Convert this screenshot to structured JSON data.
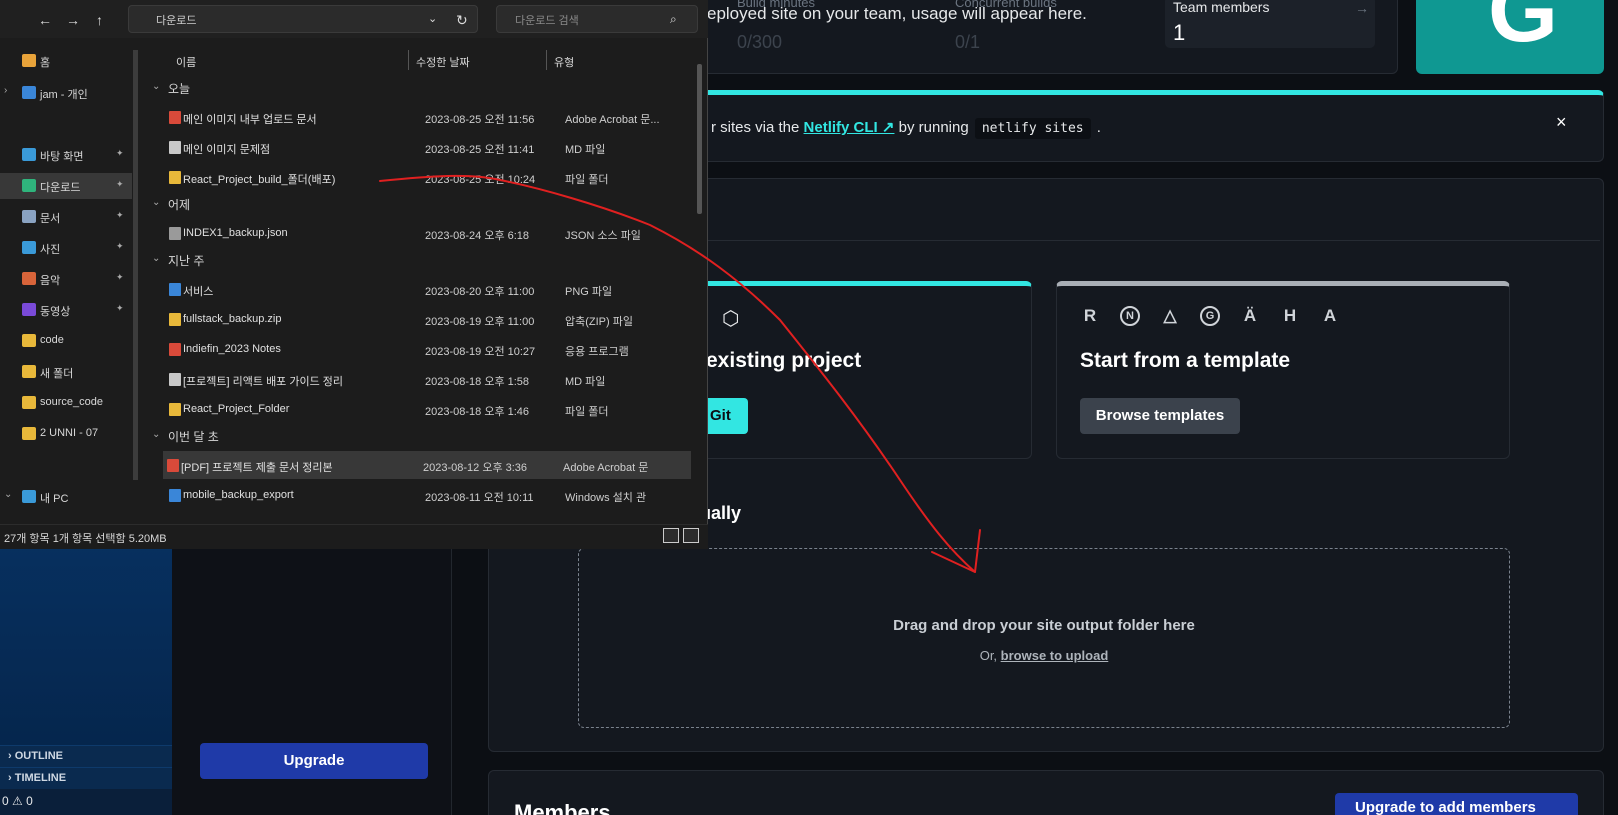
{
  "vscode": {
    "outline_label": "OUTLINE",
    "timeline_label": "TIMELINE",
    "status_text": "0 ⚠ 0"
  },
  "netlify": {
    "usage": {
      "text": "eployed site on your team, usage will appear here.",
      "build_minutes_label": "Build minutes",
      "build_minutes_value": "0/300",
      "concurrent_label": "Concurrent builds",
      "concurrent_value": "0/1"
    },
    "team": {
      "label": "Team members",
      "arrow": "→",
      "count": "1"
    },
    "avatar_letter": "G",
    "cli_banner": {
      "prefix": "r sites via the ",
      "link": "Netlify CLI ↗",
      "middle": " by running ",
      "code": "netlify sites",
      "suffix": " .",
      "close": "×"
    },
    "import_card": {
      "title": "existing project",
      "button": "Git"
    },
    "template_card": {
      "title": "Start from a template",
      "button": "Browse templates",
      "icons": [
        "R",
        "N",
        "△",
        "G",
        "Ä",
        "H",
        "A"
      ]
    },
    "manual_label": "ually",
    "dropzone": {
      "title": "Drag and drop your site output folder here",
      "sub_prefix": "Or, ",
      "sub_link": "browse to upload"
    },
    "members_title": "Members",
    "members_button": "Upgrade to add members",
    "upgrade_button": "Upgrade",
    "colors": {
      "accent": "#32e6e2",
      "upgrade": "#1f3aa8",
      "avatar": "#0f9892"
    }
  },
  "explorer": {
    "toolbar_glyphs": [
      "←",
      "→",
      "↑",
      "↻"
    ],
    "address_text": "다운로드",
    "search_placeholder": "다운로드 검색",
    "nav": [
      {
        "label": "홈"
      },
      {
        "label": "jam - 개인"
      },
      {
        "label": "바탕 화면"
      },
      {
        "label": "다운로드"
      },
      {
        "label": "문서"
      },
      {
        "label": "사진"
      },
      {
        "label": "음악"
      },
      {
        "label": "동영상"
      },
      {
        "label": "code"
      },
      {
        "label": "새 폴더"
      },
      {
        "label": "source_code"
      },
      {
        "label": "2 UNNI - 07"
      },
      {
        "label": "내 PC"
      }
    ],
    "columns": {
      "name": "이름",
      "date": "수정한 날짜",
      "type": "유형"
    },
    "groups": {
      "today": "오늘",
      "yesterday": "어제",
      "last_week": "지난 주",
      "earlier": "이번 달 초"
    },
    "rows_today": [
      {
        "name": "메인 이미지 내부 업로드 문서",
        "date": "2023-08-25 오전 11:56",
        "type": "Adobe Acrobat 문..."
      },
      {
        "name": "메인 이미지 문제점",
        "date": "2023-08-25 오전 11:41",
        "type": "MD 파일"
      },
      {
        "name": "React_Project_build_폴더(배포)",
        "date": "2023-08-25 오전 10:24",
        "type": "파일 폴더"
      }
    ],
    "rows_yesterday": [
      {
        "name": "INDEX1_backup.json",
        "date": "2023-08-24 오후 6:18",
        "type": "JSON 소스 파일"
      }
    ],
    "rows_last_week": [
      {
        "name": "서비스",
        "date": "2023-08-20 오후 11:00",
        "type": "PNG 파일"
      },
      {
        "name": "fullstack_backup.zip",
        "date": "2023-08-19 오후 11:00",
        "type": "압축(ZIP) 파일"
      },
      {
        "name": "Indiefin_2023 Notes",
        "date": "2023-08-19 오전 10:27",
        "type": "응용 프로그램"
      },
      {
        "name": "[프로젝트] 리액트 배포 가이드 정리",
        "date": "2023-08-18 오후 1:58",
        "type": "MD 파일"
      },
      {
        "name": "React_Project_Folder",
        "date": "2023-08-18 오후 1:46",
        "type": "파일 폴더"
      }
    ],
    "rows_earlier": [
      {
        "name": "[PDF] 프로젝트 제출 문서 정리본",
        "date": "2023-08-12 오후 3:36",
        "type": "Adobe Acrobat 문"
      },
      {
        "name": "mobile_backup_export",
        "date": "2023-08-11 오전 10:11",
        "type": "Windows 설치 관"
      }
    ],
    "status_text": "27개 항목    1개 항목 선택함 5.20MB"
  }
}
